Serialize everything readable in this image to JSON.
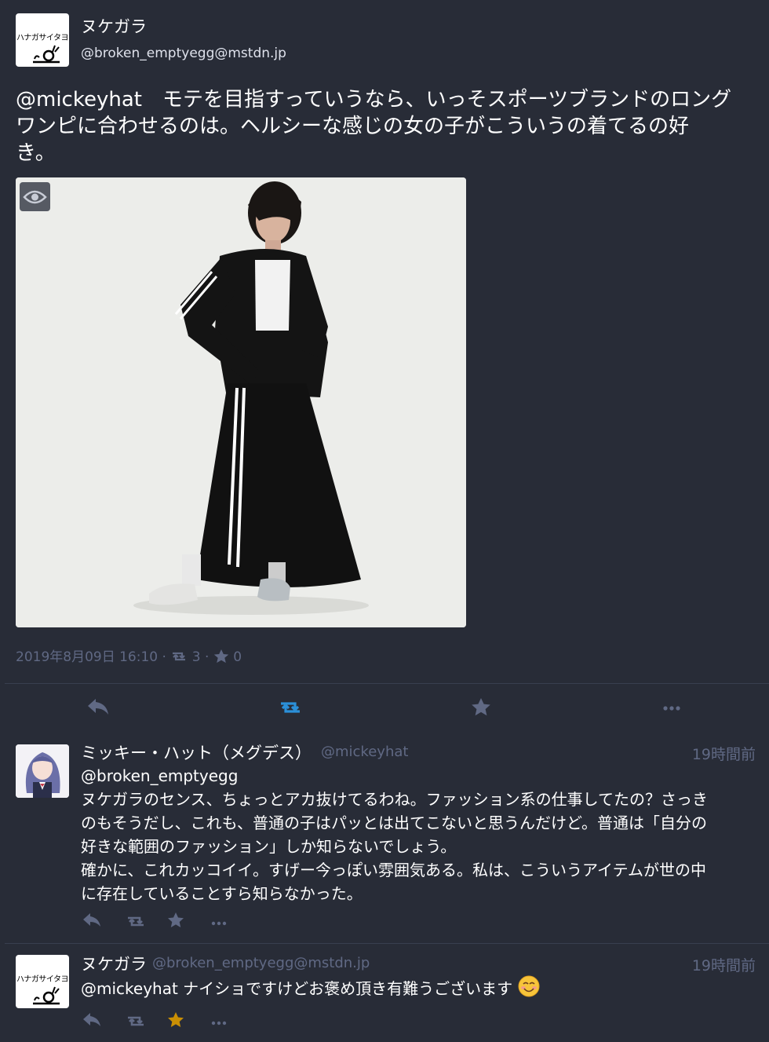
{
  "main_status": {
    "display_name": "ヌケガラ",
    "acct": "@broken_emptyegg@mstdn.jp",
    "avatar_text": "ハナガサイタヨ",
    "mention": "@mickeyhat",
    "text_line1": "　モテを目指すっていうなら、いっそスポーツブランドのロング",
    "text_line2": "ワンピに合わせるのは。ヘルシーな感じの女の子がこういうの着てるの好",
    "text_line3": "き。",
    "timestamp": "2019年8月09日 16:10",
    "separator": "·",
    "boost_count": "3",
    "fav_count": "0"
  },
  "actions": {
    "reply_icon": "reply-icon",
    "boost_icon": "boost-icon",
    "fav_icon": "star-icon",
    "more_icon": "ellipsis-icon"
  },
  "replies": [
    {
      "display_name": "ミッキー・ハット（メグデス）",
      "acct": "@mickeyhat",
      "time": "19時間前",
      "lines": [
        "@broken_emptyegg",
        "ヌケガラのセンス、ちょっとアカ抜けてるわね。ファッション系の仕事してたの？さっき",
        "のもそうだし、これも、普通の子はパッとは出てこないと思うんだけど。普通は「自分の",
        "好きな範囲のファッション」しか知らないでしょう。",
        "確かに、これカッコイイ。すげー今っぽい雰囲気ある。私は、こういうアイテムが世の中",
        "に存在していることすら知らなかった。"
      ],
      "favourited": false
    },
    {
      "display_name": "ヌケガラ",
      "acct": "@broken_emptyegg@mstdn.jp",
      "time": "19時間前",
      "avatar_text": "ハナガサイタヨ",
      "mention": "@mickeyhat",
      "text": " ナイショですけどお褒め頂き有難うございます",
      "favourited": true
    }
  ],
  "colors": {
    "background": "#282c37",
    "muted": "#606984",
    "boost_active": "#2b90d9",
    "fav_active": "#ca8f04"
  }
}
